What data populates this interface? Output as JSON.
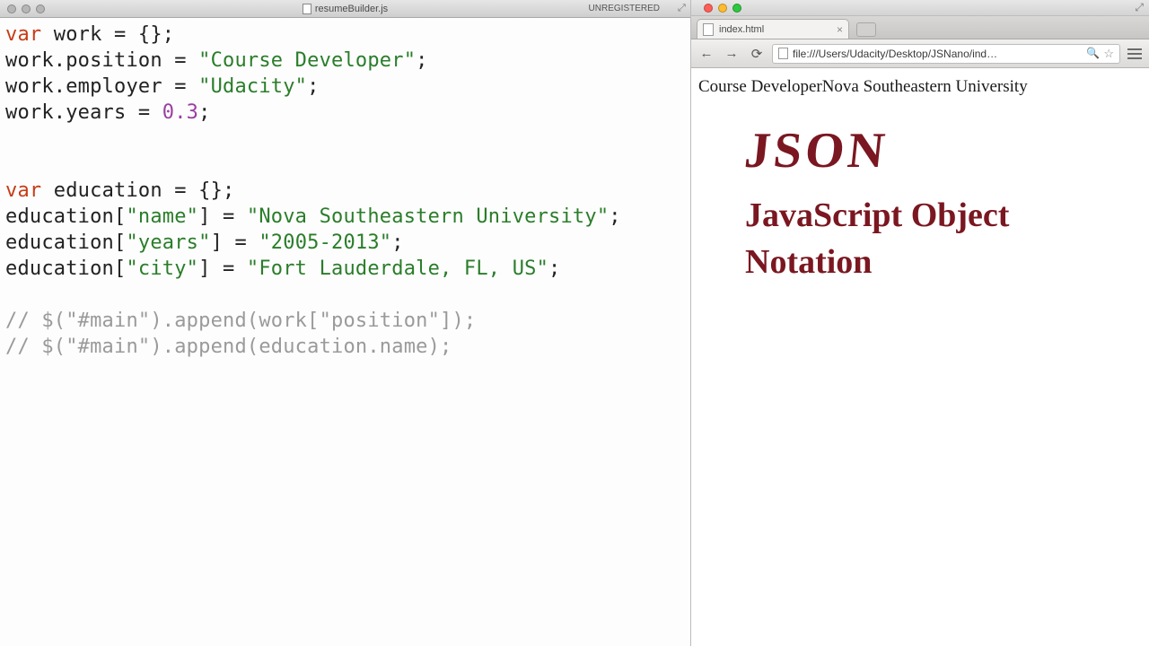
{
  "editor": {
    "filename": "resumeBuilder.js",
    "status": "UNREGISTERED",
    "code": {
      "l1_kw": "var",
      "l1_rest": " work = {};",
      "l2_a": "work.position = ",
      "l2_str": "\"Course Developer\"",
      "l2_b": ";",
      "l3_a": "work.employer = ",
      "l3_str": "\"Udacity\"",
      "l3_b": ";",
      "l4_a": "work.years = ",
      "l4_num": "0.3",
      "l4_b": ";",
      "l7_kw": "var",
      "l7_rest": " education = {};",
      "l8_a": "education[",
      "l8_k": "\"name\"",
      "l8_b": "] = ",
      "l8_v": "\"Nova Southeastern University\"",
      "l8_c": ";",
      "l9_a": "education[",
      "l9_k": "\"years\"",
      "l9_b": "] = ",
      "l9_v": "\"2005-2013\"",
      "l9_c": ";",
      "l10_a": "education[",
      "l10_k": "\"city\"",
      "l10_b": "] = ",
      "l10_v": "\"Fort Lauderdale, FL, US\"",
      "l10_c": ";",
      "l12_cmt": "// $(\"#main\").append(work[\"position\"]);",
      "l13_cmt": "// $(\"#main\").append(education.name);"
    }
  },
  "browser": {
    "tab_title": "index.html",
    "url": "file:///Users/Udacity/Desktop/JSNano/ind…",
    "page_text": "Course DeveloperNova Southeastern University",
    "handwriting": {
      "line1": "JSON",
      "line2": "JavaScript Object",
      "line3": "Notation"
    }
  }
}
